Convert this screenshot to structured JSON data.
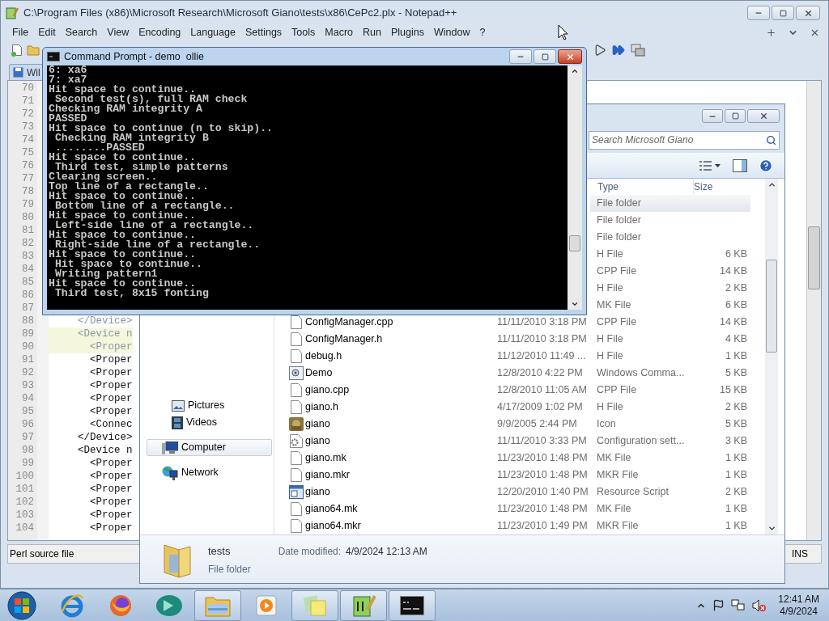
{
  "notepad": {
    "title": "C:\\Program Files (x86)\\Microsoft Research\\Microsoft Giano\\tests\\x86\\CePc2.plx - Notepad++",
    "menu": [
      "File",
      "Edit",
      "Search",
      "View",
      "Encoding",
      "Language",
      "Settings",
      "Tools",
      "Macro",
      "Run",
      "Plugins",
      "Window",
      "?"
    ],
    "tab": {
      "label": "Wil"
    },
    "lines": [
      {
        "number": "70"
      },
      {
        "number": "71"
      },
      {
        "number": "72"
      },
      {
        "number": "73"
      },
      {
        "number": "74"
      },
      {
        "number": "75"
      },
      {
        "number": "76"
      },
      {
        "number": "77"
      },
      {
        "number": "78"
      },
      {
        "number": "79"
      },
      {
        "number": "80"
      },
      {
        "number": "81"
      },
      {
        "number": "82"
      },
      {
        "number": "83"
      },
      {
        "number": "84"
      },
      {
        "number": "85"
      },
      {
        "number": "86"
      },
      {
        "number": "87"
      },
      {
        "number": "88",
        "code": "    </Device>",
        "dimmed": true,
        "highlighted": false
      },
      {
        "number": "89",
        "code": "    <Device n",
        "dimmed": true,
        "highlighted": true
      },
      {
        "number": "90",
        "code": "      <Proper",
        "dimmed": true,
        "highlighted": true
      },
      {
        "number": "91",
        "code": "      <Proper",
        "dimmed": false,
        "highlighted": false
      },
      {
        "number": "92",
        "code": "      <Proper",
        "dimmed": false,
        "highlighted": false
      },
      {
        "number": "93",
        "code": "      <Proper",
        "dimmed": false,
        "highlighted": false
      },
      {
        "number": "94",
        "code": "      <Proper",
        "dimmed": false,
        "highlighted": false
      },
      {
        "number": "95",
        "code": "      <Proper",
        "dimmed": false,
        "highlighted": false
      },
      {
        "number": "96",
        "code": "      <Connec",
        "dimmed": false,
        "highlighted": false
      },
      {
        "number": "97",
        "code": "    </Device>",
        "dimmed": false,
        "highlighted": false
      },
      {
        "number": "98",
        "code": "    <Device n",
        "dimmed": false,
        "highlighted": false
      },
      {
        "number": "99",
        "code": "      <Proper",
        "dimmed": false,
        "highlighted": false
      },
      {
        "number": "100",
        "code": "      <Proper",
        "dimmed": false,
        "highlighted": false
      },
      {
        "number": "101",
        "code": "      <Proper",
        "dimmed": false,
        "highlighted": false
      },
      {
        "number": "102",
        "code": "      <Proper",
        "dimmed": false,
        "highlighted": false
      },
      {
        "number": "103",
        "code": "      <Proper",
        "dimmed": false,
        "highlighted": false
      },
      {
        "number": "104",
        "code": "      <Proper",
        "dimmed": false,
        "highlighted": false
      }
    ],
    "status": {
      "file_type": "Perl source file",
      "mode": "INS"
    }
  },
  "explorer": {
    "search": {
      "placeholder": "Search Microsoft Giano"
    },
    "columns": [
      "Type",
      "Size"
    ],
    "nav": [
      {
        "label": "Pictures",
        "kind": "pictures",
        "selected": false
      },
      {
        "label": "Videos",
        "kind": "videos",
        "selected": false
      },
      {
        "label": "Computer",
        "kind": "computer",
        "selected": true
      },
      {
        "label": "Network",
        "kind": "network",
        "selected": false
      }
    ],
    "files": [
      {
        "type": "File folder",
        "selected": true
      },
      {
        "type": "File folder",
        "selected": false
      },
      {
        "type": "File folder",
        "selected": false
      },
      {
        "type": "H File",
        "size": "6 KB",
        "selected": false
      },
      {
        "type": "CPP File",
        "size": "14 KB",
        "selected": false
      },
      {
        "type": "H File",
        "size": "2 KB",
        "selected": false
      },
      {
        "type": "MK File",
        "size": "6 KB",
        "selected": false
      },
      {
        "name": "ConfigManager.cpp",
        "date": "11/11/2010 3:18 PM",
        "type": "CPP File",
        "size": "14 KB",
        "kind": "document",
        "selected": false
      },
      {
        "name": "ConfigManager.h",
        "date": "11/11/2010 3:18 PM",
        "type": "H File",
        "size": "4 KB",
        "kind": "document",
        "selected": false
      },
      {
        "name": "debug.h",
        "date": "11/12/2010 11:49 ...",
        "type": "H File",
        "size": "1 KB",
        "kind": "document",
        "selected": false
      },
      {
        "name": "Demo",
        "date": "12/8/2010 4:22 PM",
        "type": "Windows Comma...",
        "size": "5 KB",
        "kind": "script",
        "selected": false
      },
      {
        "name": "giano.cpp",
        "date": "12/8/2010 11:05 AM",
        "type": "CPP File",
        "size": "15 KB",
        "kind": "document",
        "selected": false
      },
      {
        "name": "giano.h",
        "date": "4/17/2009 1:02 PM",
        "type": "H File",
        "size": "2 KB",
        "kind": "document",
        "selected": false
      },
      {
        "name": "giano",
        "date": "9/9/2005 2:44 PM",
        "type": "Icon",
        "size": "5 KB",
        "kind": "image",
        "selected": false
      },
      {
        "name": "giano",
        "date": "11/11/2010 3:33 PM",
        "type": "Configuration sett...",
        "size": "3 KB",
        "kind": "settings",
        "selected": false
      },
      {
        "name": "giano.mk",
        "date": "11/23/2010 1:48 PM",
        "type": "MK File",
        "size": "1 KB",
        "kind": "document",
        "selected": false
      },
      {
        "name": "giano.mkr",
        "date": "11/23/2010 1:48 PM",
        "type": "MKR File",
        "size": "1 KB",
        "kind": "document",
        "selected": false
      },
      {
        "name": "giano",
        "date": "12/20/2010 1:40 PM",
        "type": "Resource Script",
        "size": "2 KB",
        "kind": "resource",
        "selected": false
      },
      {
        "name": "giano64.mk",
        "date": "11/23/2010 1:48 PM",
        "type": "MK File",
        "size": "1 KB",
        "kind": "document",
        "selected": false
      },
      {
        "name": "giano64.mkr",
        "date": "11/23/2010 1:49 PM",
        "type": "MKR File",
        "size": "1 KB",
        "kind": "document",
        "selected": false
      }
    ],
    "details": {
      "name": "tests",
      "type": "File folder",
      "date_label": "Date modified:",
      "date": "4/9/2024 12:13 AM"
    }
  },
  "command_prompt": {
    "title": "Command Prompt - demo  ollie",
    "output": [
      "6: xa6",
      "7: xa7",
      "Hit space to continue..",
      " Second test(s), full RAM check",
      "Checking RAM integrity A",
      "PASSED",
      "Hit space to continue (n to skip)..",
      " Checking RAM integrity B",
      " ........PASSED",
      "Hit space to continue..",
      " Third test, simple patterns",
      "Clearing screen..",
      "Top line of a rectangle..",
      "Hit space to continue..",
      " Bottom line of a rectangle..",
      "Hit space to continue..",
      " Left-side line of a rectangle..",
      "Hit space to continue..",
      " Right-side line of a rectangle..",
      "Hit space to continue..",
      " Hit space to continue..",
      " Writing pattern1",
      "Hit space to continue..",
      " Third test, 8x15 fonting"
    ]
  },
  "taskbar": {
    "apps": [
      {
        "kind": "browser-e",
        "running": false
      },
      {
        "kind": "fox",
        "running": false
      },
      {
        "kind": "teal",
        "running": false
      },
      {
        "kind": "folder",
        "running": true
      },
      {
        "kind": "media",
        "running": false
      },
      {
        "kind": "notes",
        "running": true
      },
      {
        "kind": "editor",
        "running": true
      },
      {
        "kind": "console",
        "running": true
      }
    ],
    "clock": {
      "time": "12:41 AM",
      "date": "4/9/2024"
    }
  }
}
